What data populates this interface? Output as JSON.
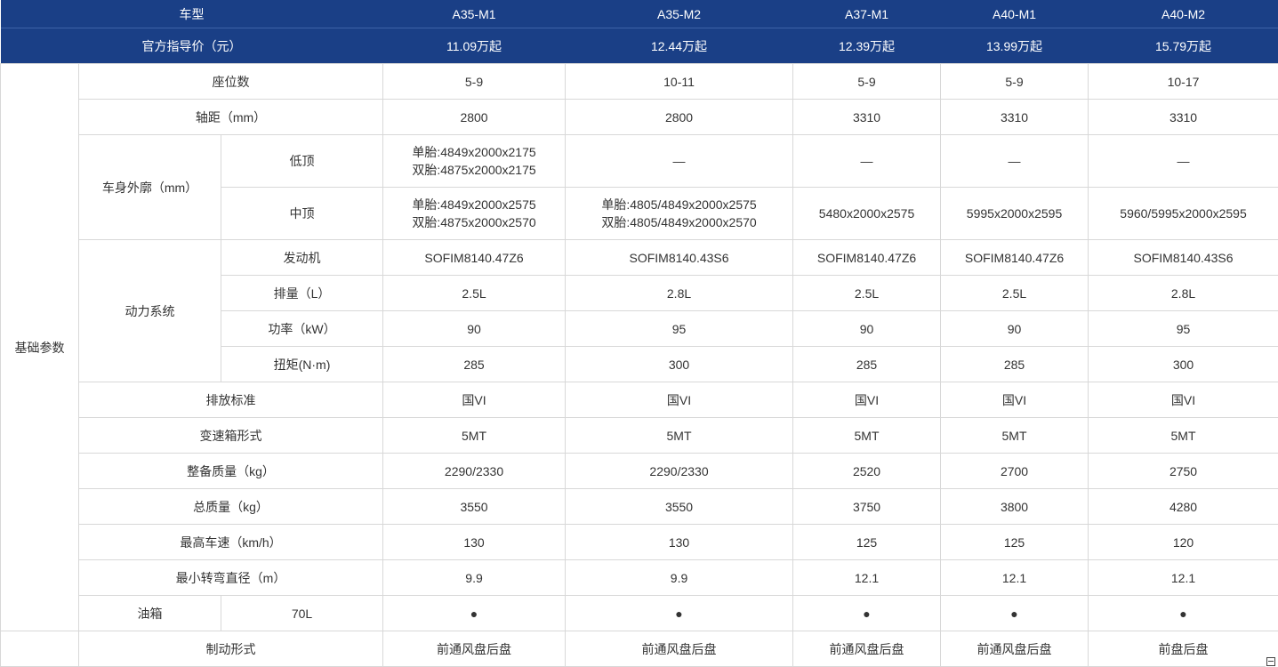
{
  "header": {
    "label": "车型",
    "models": [
      "A35-M1",
      "A35-M2",
      "A37-M1",
      "A40-M1",
      "A40-M2"
    ]
  },
  "price": {
    "label": "官方指导价（元）",
    "values": [
      "11.09万起",
      "12.44万起",
      "12.39万起",
      "13.99万起",
      "15.79万起"
    ]
  },
  "basic": {
    "group_label": "基础参数",
    "seats": {
      "label": "座位数",
      "values": [
        "5-9",
        "10-11",
        "5-9",
        "5-9",
        "10-17"
      ]
    },
    "wheelbase": {
      "label": "轴距（mm）",
      "values": [
        "2800",
        "2800",
        "3310",
        "3310",
        "3310"
      ]
    },
    "body": {
      "label": "车身外廓（mm）",
      "low_roof": {
        "label": "低顶",
        "m1_single": "单胎:4849x2000x2175",
        "m1_dual": "双胎:4875x2000x2175",
        "others": [
          "—",
          "—",
          "—",
          "—"
        ]
      },
      "mid_roof": {
        "label": "中顶",
        "m1_single": "单胎:4849x2000x2575",
        "m1_dual": "双胎:4875x2000x2570",
        "m2_single": "单胎:4805/4849x2000x2575",
        "m2_dual": "双胎:4805/4849x2000x2570",
        "others": [
          "5480x2000x2575",
          "5995x2000x2595",
          "5960/5995x2000x2595"
        ]
      }
    },
    "power": {
      "label": "动力系统",
      "engine": {
        "label": "发动机",
        "values": [
          "SOFIM8140.47Z6",
          "SOFIM8140.43S6",
          "SOFIM8140.47Z6",
          "SOFIM8140.47Z6",
          "SOFIM8140.43S6"
        ]
      },
      "displacement": {
        "label": "排量（L）",
        "values": [
          "2.5L",
          "2.8L",
          "2.5L",
          "2.5L",
          "2.8L"
        ]
      },
      "power": {
        "label": "功率（kW）",
        "values": [
          "90",
          "95",
          "90",
          "90",
          "95"
        ]
      },
      "torque": {
        "label": "扭矩(N·m)",
        "values": [
          "285",
          "300",
          "285",
          "285",
          "300"
        ]
      }
    },
    "emission": {
      "label": "排放标准",
      "values": [
        "国VI",
        "国VI",
        "国VI",
        "国VI",
        "国VI"
      ]
    },
    "gearbox": {
      "label": "变速箱形式",
      "values": [
        "5MT",
        "5MT",
        "5MT",
        "5MT",
        "5MT"
      ]
    },
    "curb_weight": {
      "label": "整备质量（kg）",
      "values": [
        "2290/2330",
        "2290/2330",
        "2520",
        "2700",
        "2750"
      ]
    },
    "gross_weight": {
      "label": "总质量（kg）",
      "values": [
        "3550",
        "3550",
        "3750",
        "3800",
        "4280"
      ]
    },
    "top_speed": {
      "label": "最高车速（km/h）",
      "values": [
        "130",
        "130",
        "125",
        "125",
        "120"
      ]
    },
    "turning": {
      "label": "最小转弯直径（m）",
      "values": [
        "9.9",
        "9.9",
        "12.1",
        "12.1",
        "12.1"
      ]
    },
    "fuel": {
      "label": "油箱",
      "capacity": "70L",
      "values": [
        "●",
        "●",
        "●",
        "●",
        "●"
      ]
    }
  },
  "brake": {
    "label": "制动形式",
    "values": [
      "前通风盘后盘",
      "前通风盘后盘",
      "前通风盘后盘",
      "前通风盘后盘",
      "前盘后盘"
    ]
  },
  "icons": {
    "corner": "window-restore-icon"
  }
}
